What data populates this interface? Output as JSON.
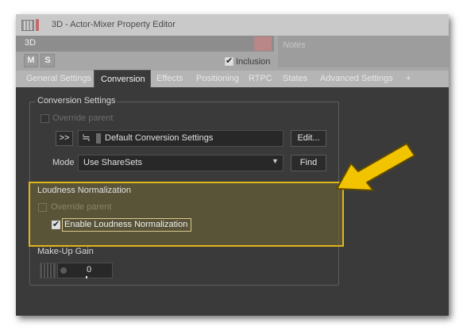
{
  "window": {
    "title": "3D - Actor-Mixer Property Editor",
    "object_name": "3D",
    "notes_placeholder": "Notes",
    "mute_label": "M",
    "solo_label": "S",
    "inclusion_label": "Inclusion"
  },
  "tabs": [
    {
      "label": "General Settings"
    },
    {
      "label": "Conversion",
      "active": true
    },
    {
      "label": "Effects"
    },
    {
      "label": "Positioning"
    },
    {
      "label": "RTPC"
    },
    {
      "label": "States"
    },
    {
      "label": "Advanced Settings"
    },
    {
      "label": "+"
    }
  ],
  "conversion_settings": {
    "group_title": "Conversion Settings",
    "override_parent_label": "Override parent",
    "share_btn_label": ">>",
    "shareset_name": "Default Conversion Settings",
    "edit_label": "Edit...",
    "mode_label": "Mode",
    "mode_value": "Use ShareSets",
    "find_label": "Find"
  },
  "loudness": {
    "group_title": "Loudness Normalization",
    "override_parent_label": "Override parent",
    "enable_label": "Enable Loudness Normalization",
    "enable_checked": true
  },
  "makeup_gain": {
    "label": "Make-Up Gain",
    "value": "0"
  },
  "colors": {
    "highlight_border": "#e0b71b",
    "arrow": "#f2c400"
  }
}
